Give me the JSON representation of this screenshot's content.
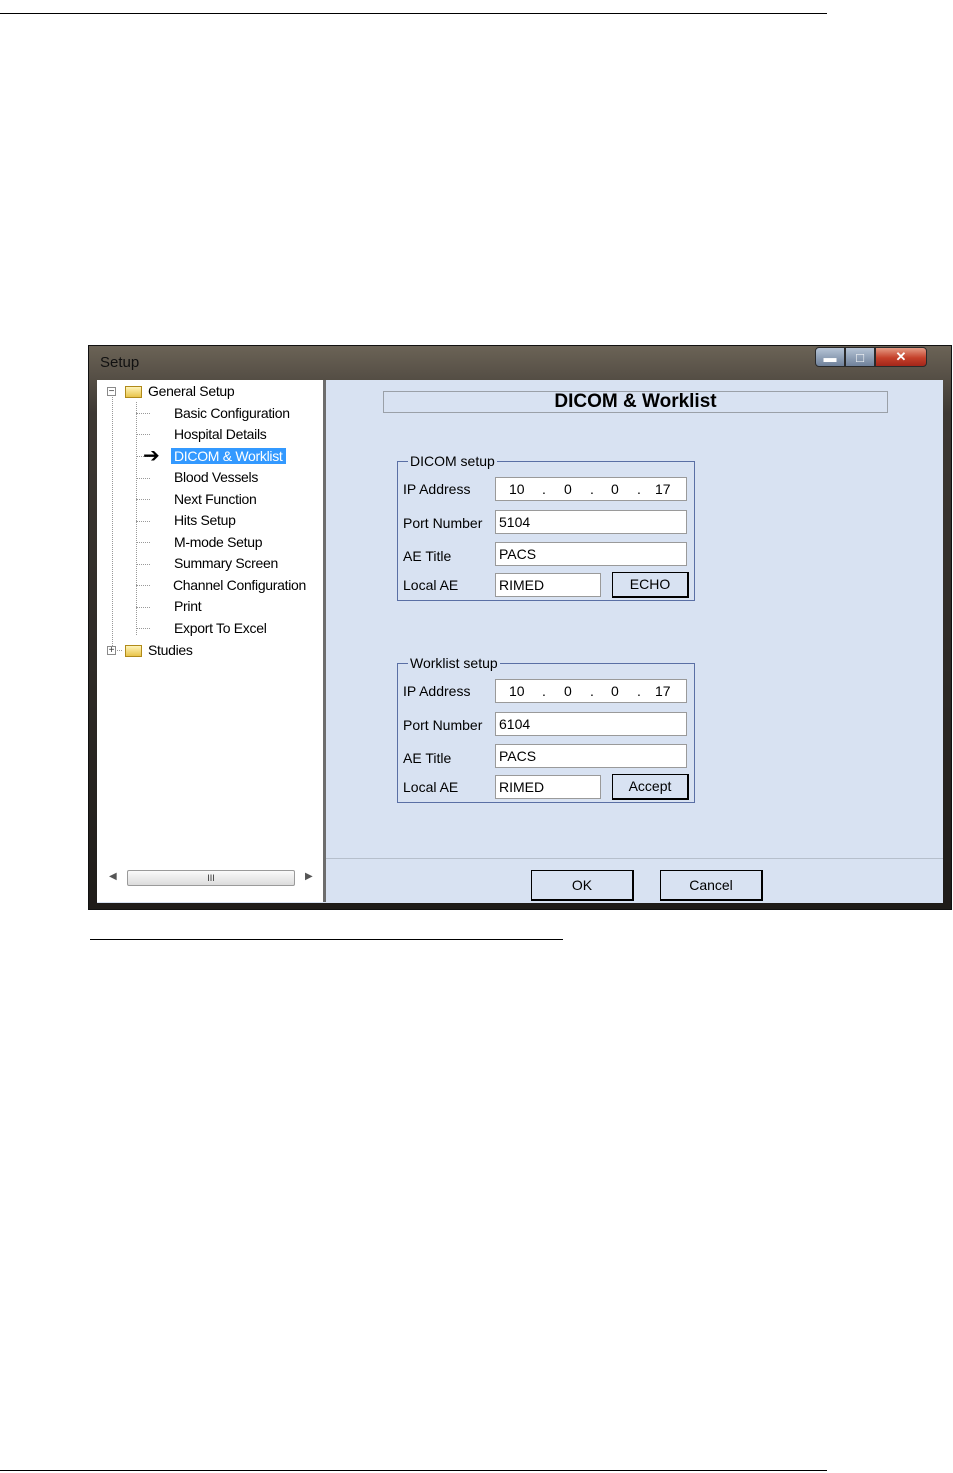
{
  "window": {
    "title": "Setup"
  },
  "tree": {
    "root": "General Setup",
    "items": [
      "Basic Configuration",
      "Hospital Details",
      "DICOM & Worklist",
      "Blood Vessels",
      "Next Function",
      "Hits Setup",
      "M-mode Setup",
      "Summary Screen",
      "Channel Configuration",
      "Print",
      "Export To Excel"
    ],
    "selected_index": 2,
    "second_root": "Studies",
    "scroll_thumb": "III"
  },
  "pane": {
    "title": "DICOM & Worklist"
  },
  "dicom": {
    "legend": "DICOM setup",
    "ip_label": "IP Address",
    "ip": [
      "10",
      "0",
      "0",
      "17"
    ],
    "port_label": "Port Number",
    "port": "5104",
    "ae_label": "AE Title",
    "ae": "PACS",
    "local_label": "Local AE",
    "local": "RIMED",
    "button": "ECHO"
  },
  "worklist": {
    "legend": "Worklist setup",
    "ip_label": "IP Address",
    "ip": [
      "10",
      "0",
      "0",
      "17"
    ],
    "port_label": "Port Number",
    "port": "6104",
    "ae_label": "AE Title",
    "ae": "PACS",
    "local_label": "Local AE",
    "local": "RIMED",
    "button": "Accept"
  },
  "footer": {
    "ok": "OK",
    "cancel": "Cancel"
  },
  "colors": {
    "selection": "#3399ff",
    "client_bg": "#d8e2f2",
    "close_button": "#c4402a"
  }
}
